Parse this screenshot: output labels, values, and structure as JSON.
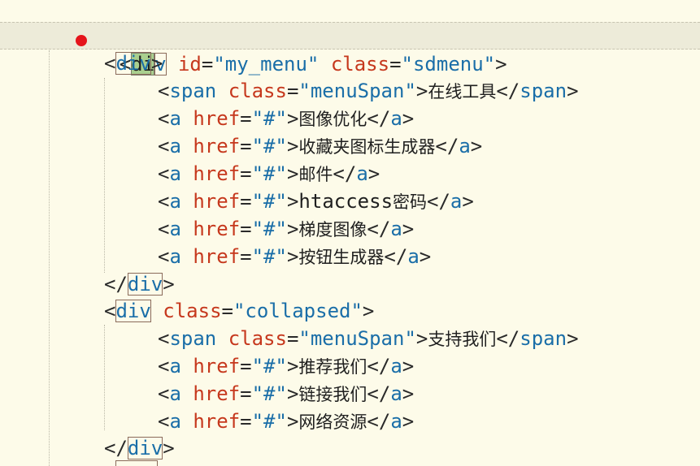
{
  "colors": {
    "background": "#fdfbe9",
    "current_line": "#edebd9",
    "tag": "#1a6ea8",
    "attribute": "#c6381d",
    "string": "#1a6ea8",
    "cursor_highlight": "#a9cf8e",
    "pointer": "#e5141b"
  },
  "code": {
    "l1": {
      "lt": "<",
      "tag_a": "di",
      "tag_b": "v",
      "attr1": "id",
      "eq1": "=",
      "val1": "\"my_menu\"",
      "attr2": "class",
      "eq2": "=",
      "val2": "\"sdmenu\"",
      "gt": ">"
    },
    "l2": {
      "lt": "<",
      "tag": "div",
      "gt": ">"
    },
    "l3": {
      "lt": "<",
      "tag": "span",
      "attr": "class",
      "eq": "=",
      "val": "\"menuSpan\"",
      "gt": ">",
      "text": "在线工具",
      "close_lt": "</",
      "close_tag": "span",
      "close_gt": ">"
    },
    "l4": {
      "lt": "<",
      "tag": "a",
      "attr": "href",
      "eq": "=",
      "val": "\"#\"",
      "gt": ">",
      "text": "图像优化",
      "close_lt": "</",
      "close_tag": "a",
      "close_gt": ">"
    },
    "l5": {
      "lt": "<",
      "tag": "a",
      "attr": "href",
      "eq": "=",
      "val": "\"#\"",
      "gt": ">",
      "text": "收藏夹图标生成器",
      "close_lt": "</",
      "close_tag": "a",
      "close_gt": ">"
    },
    "l6": {
      "lt": "<",
      "tag": "a",
      "attr": "href",
      "eq": "=",
      "val": "\"#\"",
      "gt": ">",
      "text": "邮件",
      "close_lt": "</",
      "close_tag": "a",
      "close_gt": ">"
    },
    "l7": {
      "lt": "<",
      "tag": "a",
      "attr": "href",
      "eq": "=",
      "val": "\"#\"",
      "gt": ">",
      "text_latin": "htaccess",
      "text": "密码",
      "close_lt": "</",
      "close_tag": "a",
      "close_gt": ">"
    },
    "l8": {
      "lt": "<",
      "tag": "a",
      "attr": "href",
      "eq": "=",
      "val": "\"#\"",
      "gt": ">",
      "text": "梯度图像",
      "close_lt": "</",
      "close_tag": "a",
      "close_gt": ">"
    },
    "l9": {
      "lt": "<",
      "tag": "a",
      "attr": "href",
      "eq": "=",
      "val": "\"#\"",
      "gt": ">",
      "text": "按钮生成器",
      "close_lt": "</",
      "close_tag": "a",
      "close_gt": ">"
    },
    "l10": {
      "lt": "</",
      "tag": "div",
      "gt": ">"
    },
    "l11": {
      "lt": "<",
      "tag": "div",
      "attr": "class",
      "eq": "=",
      "val": "\"collapsed\"",
      "gt": ">"
    },
    "l12": {
      "lt": "<",
      "tag": "span",
      "attr": "class",
      "eq": "=",
      "val": "\"menuSpan\"",
      "gt": ">",
      "text": "支持我们",
      "close_lt": "</",
      "close_tag": "span",
      "close_gt": ">"
    },
    "l13": {
      "lt": "<",
      "tag": "a",
      "attr": "href",
      "eq": "=",
      "val": "\"#\"",
      "gt": ">",
      "text": "推荐我们",
      "close_lt": "</",
      "close_tag": "a",
      "close_gt": ">"
    },
    "l14": {
      "lt": "<",
      "tag": "a",
      "attr": "href",
      "eq": "=",
      "val": "\"#\"",
      "gt": ">",
      "text": "链接我们",
      "close_lt": "</",
      "close_tag": "a",
      "close_gt": ">"
    },
    "l15": {
      "lt": "<",
      "tag": "a",
      "attr": "href",
      "eq": "=",
      "val": "\"#\"",
      "gt": ">",
      "text": "网络资源",
      "close_lt": "</",
      "close_tag": "a",
      "close_gt": ">"
    },
    "l16": {
      "lt": "</",
      "tag": "div",
      "gt": ">"
    }
  }
}
